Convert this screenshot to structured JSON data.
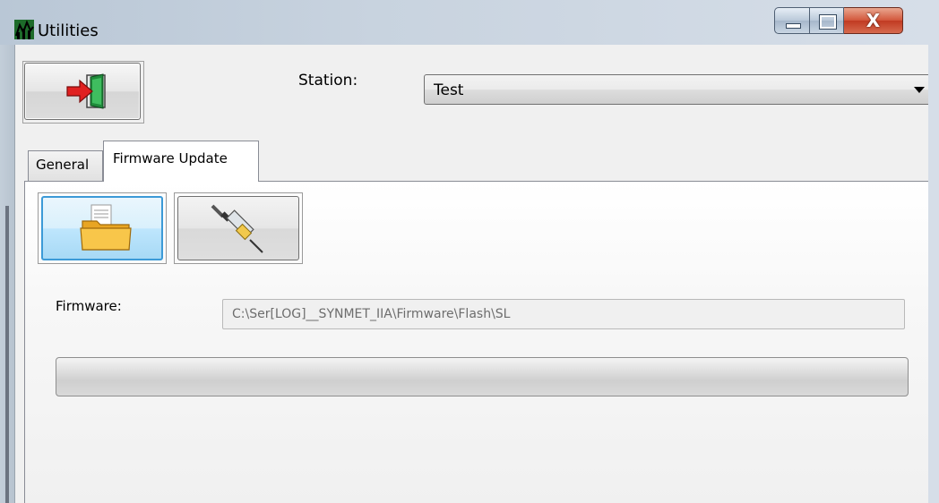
{
  "window": {
    "title": "Utilities",
    "close_glyph": "X",
    "icons": {
      "app": "app-chart-icon",
      "minimize": "minimize-icon",
      "maximize": "maximize-icon",
      "close": "close-icon"
    }
  },
  "toolbar": {
    "exit_icon": "exit-door-icon",
    "station_label": "Station:",
    "station_value": "Test"
  },
  "tabs": [
    {
      "label": "General",
      "selected": false
    },
    {
      "label": "Firmware Update",
      "selected": true
    }
  ],
  "firmware_panel": {
    "open_button_icon": "folder-open-icon",
    "flash_button_icon": "syringe-icon",
    "firmware_label": "Firmware:",
    "firmware_path": "C:\\Ser[LOG]__SYNMET_IIA\\Firmware\\Flash\\SL",
    "progress": 0
  },
  "colors": {
    "accent": "#3c9ad7",
    "close_red": "#c13a22"
  }
}
